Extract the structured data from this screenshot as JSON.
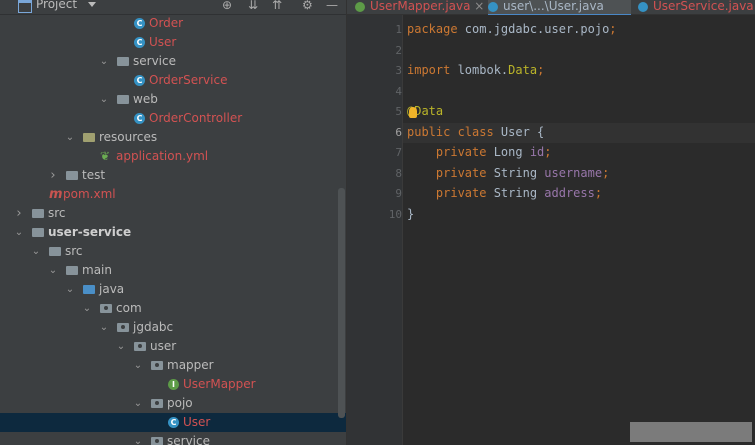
{
  "project_panel": {
    "title": "Project",
    "toolbar_icons": [
      "crosshair-icon",
      "expand-icon",
      "collapse-icon",
      "gear-icon",
      "minimize-icon"
    ]
  },
  "tree": [
    {
      "label": "Order",
      "icon": "class",
      "color": "red",
      "indent": 4,
      "arrow": ""
    },
    {
      "label": "User",
      "icon": "class",
      "color": "red",
      "indent": 4,
      "arrow": ""
    },
    {
      "label": "service",
      "icon": "folder",
      "color": "",
      "indent": 3,
      "arrow": "down"
    },
    {
      "label": "OrderService",
      "icon": "class",
      "color": "red",
      "indent": 4,
      "arrow": ""
    },
    {
      "label": "web",
      "icon": "folder",
      "color": "",
      "indent": 3,
      "arrow": "down"
    },
    {
      "label": "OrderController",
      "icon": "class",
      "color": "red",
      "indent": 4,
      "arrow": ""
    },
    {
      "label": "resources",
      "icon": "resources",
      "color": "",
      "indent": 1,
      "arrow": "down"
    },
    {
      "label": "application.yml",
      "icon": "leaf",
      "color": "red",
      "indent": 2,
      "arrow": ""
    },
    {
      "label": "test",
      "icon": "folder",
      "color": "",
      "indent": 0,
      "arrow": "right"
    },
    {
      "label": "pom.xml",
      "icon": "maven",
      "color": "red",
      "indent": -1,
      "arrow": ""
    },
    {
      "label": "src",
      "icon": "folder",
      "color": "",
      "indent": -2,
      "arrow": "right"
    },
    {
      "label": "user-service",
      "icon": "module",
      "color": "bold",
      "indent": -2,
      "arrow": "down"
    },
    {
      "label": "src",
      "icon": "folder",
      "color": "",
      "indent": -1,
      "arrow": "down"
    },
    {
      "label": "main",
      "icon": "folder",
      "color": "",
      "indent": 0,
      "arrow": "down"
    },
    {
      "label": "java",
      "icon": "folder-blue",
      "color": "",
      "indent": 1,
      "arrow": "down"
    },
    {
      "label": "com",
      "icon": "package",
      "color": "",
      "indent": 2,
      "arrow": "down"
    },
    {
      "label": "jgdabc",
      "icon": "package",
      "color": "",
      "indent": 3,
      "arrow": "down"
    },
    {
      "label": "user",
      "icon": "package",
      "color": "",
      "indent": 4,
      "arrow": "down"
    },
    {
      "label": "mapper",
      "icon": "package",
      "color": "",
      "indent": 5,
      "arrow": "down"
    },
    {
      "label": "UserMapper",
      "icon": "interface",
      "color": "red",
      "indent": 6,
      "arrow": ""
    },
    {
      "label": "pojo",
      "icon": "package",
      "color": "",
      "indent": 5,
      "arrow": "down"
    },
    {
      "label": "User",
      "icon": "class",
      "color": "red",
      "indent": 6,
      "arrow": "",
      "selected": true
    },
    {
      "label": "service",
      "icon": "package",
      "color": "",
      "indent": 5,
      "arrow": "down"
    }
  ],
  "tabs": [
    {
      "label": "UserMapper.java",
      "icon_color": "#5d9b47",
      "active": false
    },
    {
      "label": "user\\...\\User.java",
      "icon_color": "#3592c4",
      "active": true
    },
    {
      "label": "UserService.java",
      "icon_color": "#3592c4",
      "active": false
    }
  ],
  "editor": {
    "line_numbers": [
      "1",
      "2",
      "3",
      "4",
      "5",
      "6",
      "7",
      "8",
      "9",
      "10"
    ],
    "current_line": 6,
    "lines": [
      [
        {
          "t": "package",
          "c": "kw"
        },
        {
          "t": " com.jgdabc.user.pojo",
          "c": ""
        },
        {
          "t": ";",
          "c": "kw"
        }
      ],
      [],
      [
        {
          "t": "import",
          "c": "kw"
        },
        {
          "t": " lombok.",
          "c": ""
        },
        {
          "t": "Data",
          "c": "ann"
        },
        {
          "t": ";",
          "c": "kw"
        }
      ],
      [],
      [
        {
          "t": "@Data",
          "c": "ann"
        }
      ],
      [
        {
          "t": "public class ",
          "c": "kw"
        },
        {
          "t": "User {",
          "c": ""
        }
      ],
      [
        {
          "t": "    private ",
          "c": "kw"
        },
        {
          "t": "Long ",
          "c": ""
        },
        {
          "t": "id",
          "c": "fld"
        },
        {
          "t": ";",
          "c": "kw"
        }
      ],
      [
        {
          "t": "    private ",
          "c": "kw"
        },
        {
          "t": "String ",
          "c": ""
        },
        {
          "t": "username",
          "c": "fld"
        },
        {
          "t": ";",
          "c": "kw"
        }
      ],
      [
        {
          "t": "    private ",
          "c": "kw"
        },
        {
          "t": "String ",
          "c": ""
        },
        {
          "t": "address",
          "c": "fld"
        },
        {
          "t": ";",
          "c": "kw"
        }
      ],
      [
        {
          "t": "}",
          "c": ""
        }
      ]
    ]
  }
}
